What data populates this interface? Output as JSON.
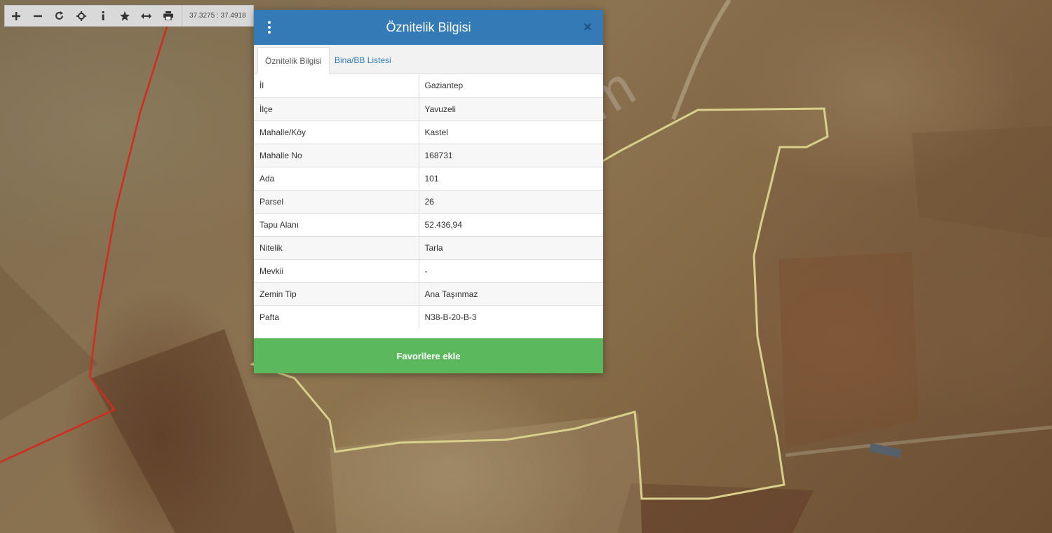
{
  "toolbar": {
    "buttons": [
      {
        "name": "zoom-in-icon",
        "glyph": "+"
      },
      {
        "name": "zoom-out-icon",
        "glyph": "−"
      },
      {
        "name": "refresh-icon",
        "glyph": "⟳"
      },
      {
        "name": "locate-icon",
        "glyph": "⌖"
      },
      {
        "name": "info-icon",
        "glyph": "i"
      },
      {
        "name": "star-icon",
        "glyph": "★"
      },
      {
        "name": "measure-icon",
        "glyph": "↔"
      },
      {
        "name": "print-icon",
        "glyph": "⎙"
      }
    ],
    "coordinates": "37.3275 : 37.4918"
  },
  "modal": {
    "title": "Öznitelik Bilgisi",
    "tabs": [
      {
        "label": "Öznitelik Bilgisi",
        "active": true
      },
      {
        "label": "Bina/BB Listesi",
        "active": false
      }
    ],
    "rows": [
      {
        "key": "İl",
        "value": "Gaziantep"
      },
      {
        "key": "İlçe",
        "value": "Yavuzeli"
      },
      {
        "key": "Mahalle/Köy",
        "value": "Kastel"
      },
      {
        "key": "Mahalle No",
        "value": "168731"
      },
      {
        "key": "Ada",
        "value": "101"
      },
      {
        "key": "Parsel",
        "value": "26"
      },
      {
        "key": "Tapu Alanı",
        "value": "52.436,94"
      },
      {
        "key": "Nitelik",
        "value": "Tarla"
      },
      {
        "key": "Mevkii",
        "value": "-"
      },
      {
        "key": "Zemin Tip",
        "value": "Ana Taşınmaz"
      },
      {
        "key": "Pafta",
        "value": "N38-B-20-B-3"
      }
    ],
    "favorite_button": "Favorilere ekle"
  },
  "watermark": "emlakjet.com",
  "colors": {
    "header": "#337ab7",
    "favorite_button": "#5cb85c",
    "parcel_outline": "#d8cf8a",
    "boundary_line": "#d22a1e"
  }
}
